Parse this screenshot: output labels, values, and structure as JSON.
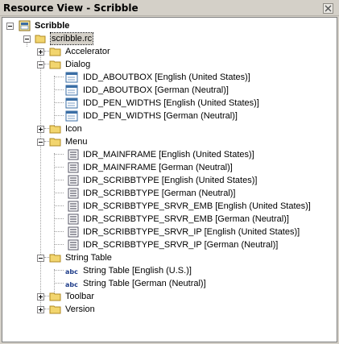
{
  "window": {
    "title": "Resource View - Scribble"
  },
  "tree": {
    "root_label": "Scribble",
    "rc_label": "scribble.rc",
    "folders": {
      "accelerator": "Accelerator",
      "dialog": "Dialog",
      "icon": "Icon",
      "menu": "Menu",
      "string_table": "String Table",
      "toolbar": "Toolbar",
      "version": "Version"
    },
    "dialogs": [
      "IDD_ABOUTBOX [English (United States)]",
      "IDD_ABOUTBOX [German (Neutral)]",
      "IDD_PEN_WIDTHS [English (United States)]",
      "IDD_PEN_WIDTHS [German (Neutral)]"
    ],
    "menus": [
      "IDR_MAINFRAME [English (United States)]",
      "IDR_MAINFRAME [German (Neutral)]",
      "IDR_SCRIBBTYPE [English (United States)]",
      "IDR_SCRIBBTYPE [German (Neutral)]",
      "IDR_SCRIBBTYPE_SRVR_EMB [English (United States)]",
      "IDR_SCRIBBTYPE_SRVR_EMB [German (Neutral)]",
      "IDR_SCRIBBTYPE_SRVR_IP [English (United States)]",
      "IDR_SCRIBBTYPE_SRVR_IP [German (Neutral)]"
    ],
    "strings": [
      "String Table [English (U.S.)]",
      "String Table [German (Neutral)]"
    ]
  },
  "colors": {
    "folder": "#f2d56e",
    "folder_edge": "#b08a22",
    "dialog_icon": "#3a6ea5",
    "selection": "#d4d0c8"
  }
}
